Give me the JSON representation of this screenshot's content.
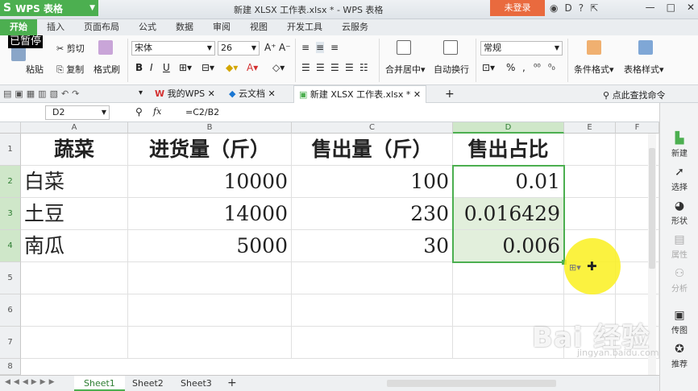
{
  "app": {
    "logo": "WPS 表格",
    "title": "新建 XLSX 工作表.xlsx * - WPS 表格",
    "login": "未登录"
  },
  "menu_tabs": [
    "开始",
    "插入",
    "页面布局",
    "公式",
    "数据",
    "审阅",
    "视图",
    "开发工具",
    "云服务"
  ],
  "overlay": {
    "paused": "已暂停"
  },
  "ribbon": {
    "cut": "剪切",
    "copy": "复制",
    "paste": "粘贴",
    "format_painter": "格式刷",
    "font_name": "宋体",
    "font_size": "26",
    "merge_center": "合并居中",
    "wrap_text": "自动换行",
    "number_format": "常规",
    "percent": "%",
    "conditional_format": "条件格式",
    "table_style": "表格样式"
  },
  "quickbar": {
    "my_wps": "我的WPS",
    "cloud_docs": "云文档",
    "doc_tab": "新建 XLSX 工作表.xlsx *",
    "find_cmd": "点此查找命令"
  },
  "formula_bar": {
    "cell_ref": "D2",
    "fx": "fx",
    "formula": "=C2/B2"
  },
  "columns": [
    "A",
    "B",
    "C",
    "D",
    "E",
    "F"
  ],
  "rows": [
    "1",
    "2",
    "3",
    "4",
    "5",
    "6",
    "7",
    "8"
  ],
  "table": {
    "header": [
      "蔬菜",
      "进货量（斤）",
      "售出量（斤）",
      "售出占比"
    ],
    "data": [
      [
        "白菜",
        "10000",
        "100",
        "0.01"
      ],
      [
        "土豆",
        "14000",
        "230",
        "0.016429"
      ],
      [
        "南瓜",
        "5000",
        "30",
        "0.006"
      ]
    ]
  },
  "sheets": [
    "Sheet1",
    "Sheet2",
    "Sheet3"
  ],
  "right_panel": [
    "新建",
    "选择",
    "形状",
    "属性",
    "分析",
    "传图",
    "推荐"
  ],
  "watermark": {
    "main": "Bai 经验",
    "sub": "jingyan.baidu.com"
  },
  "colors": {
    "accent": "#4caf50",
    "login": "#e96a3e",
    "selection": "#e2efdc"
  }
}
